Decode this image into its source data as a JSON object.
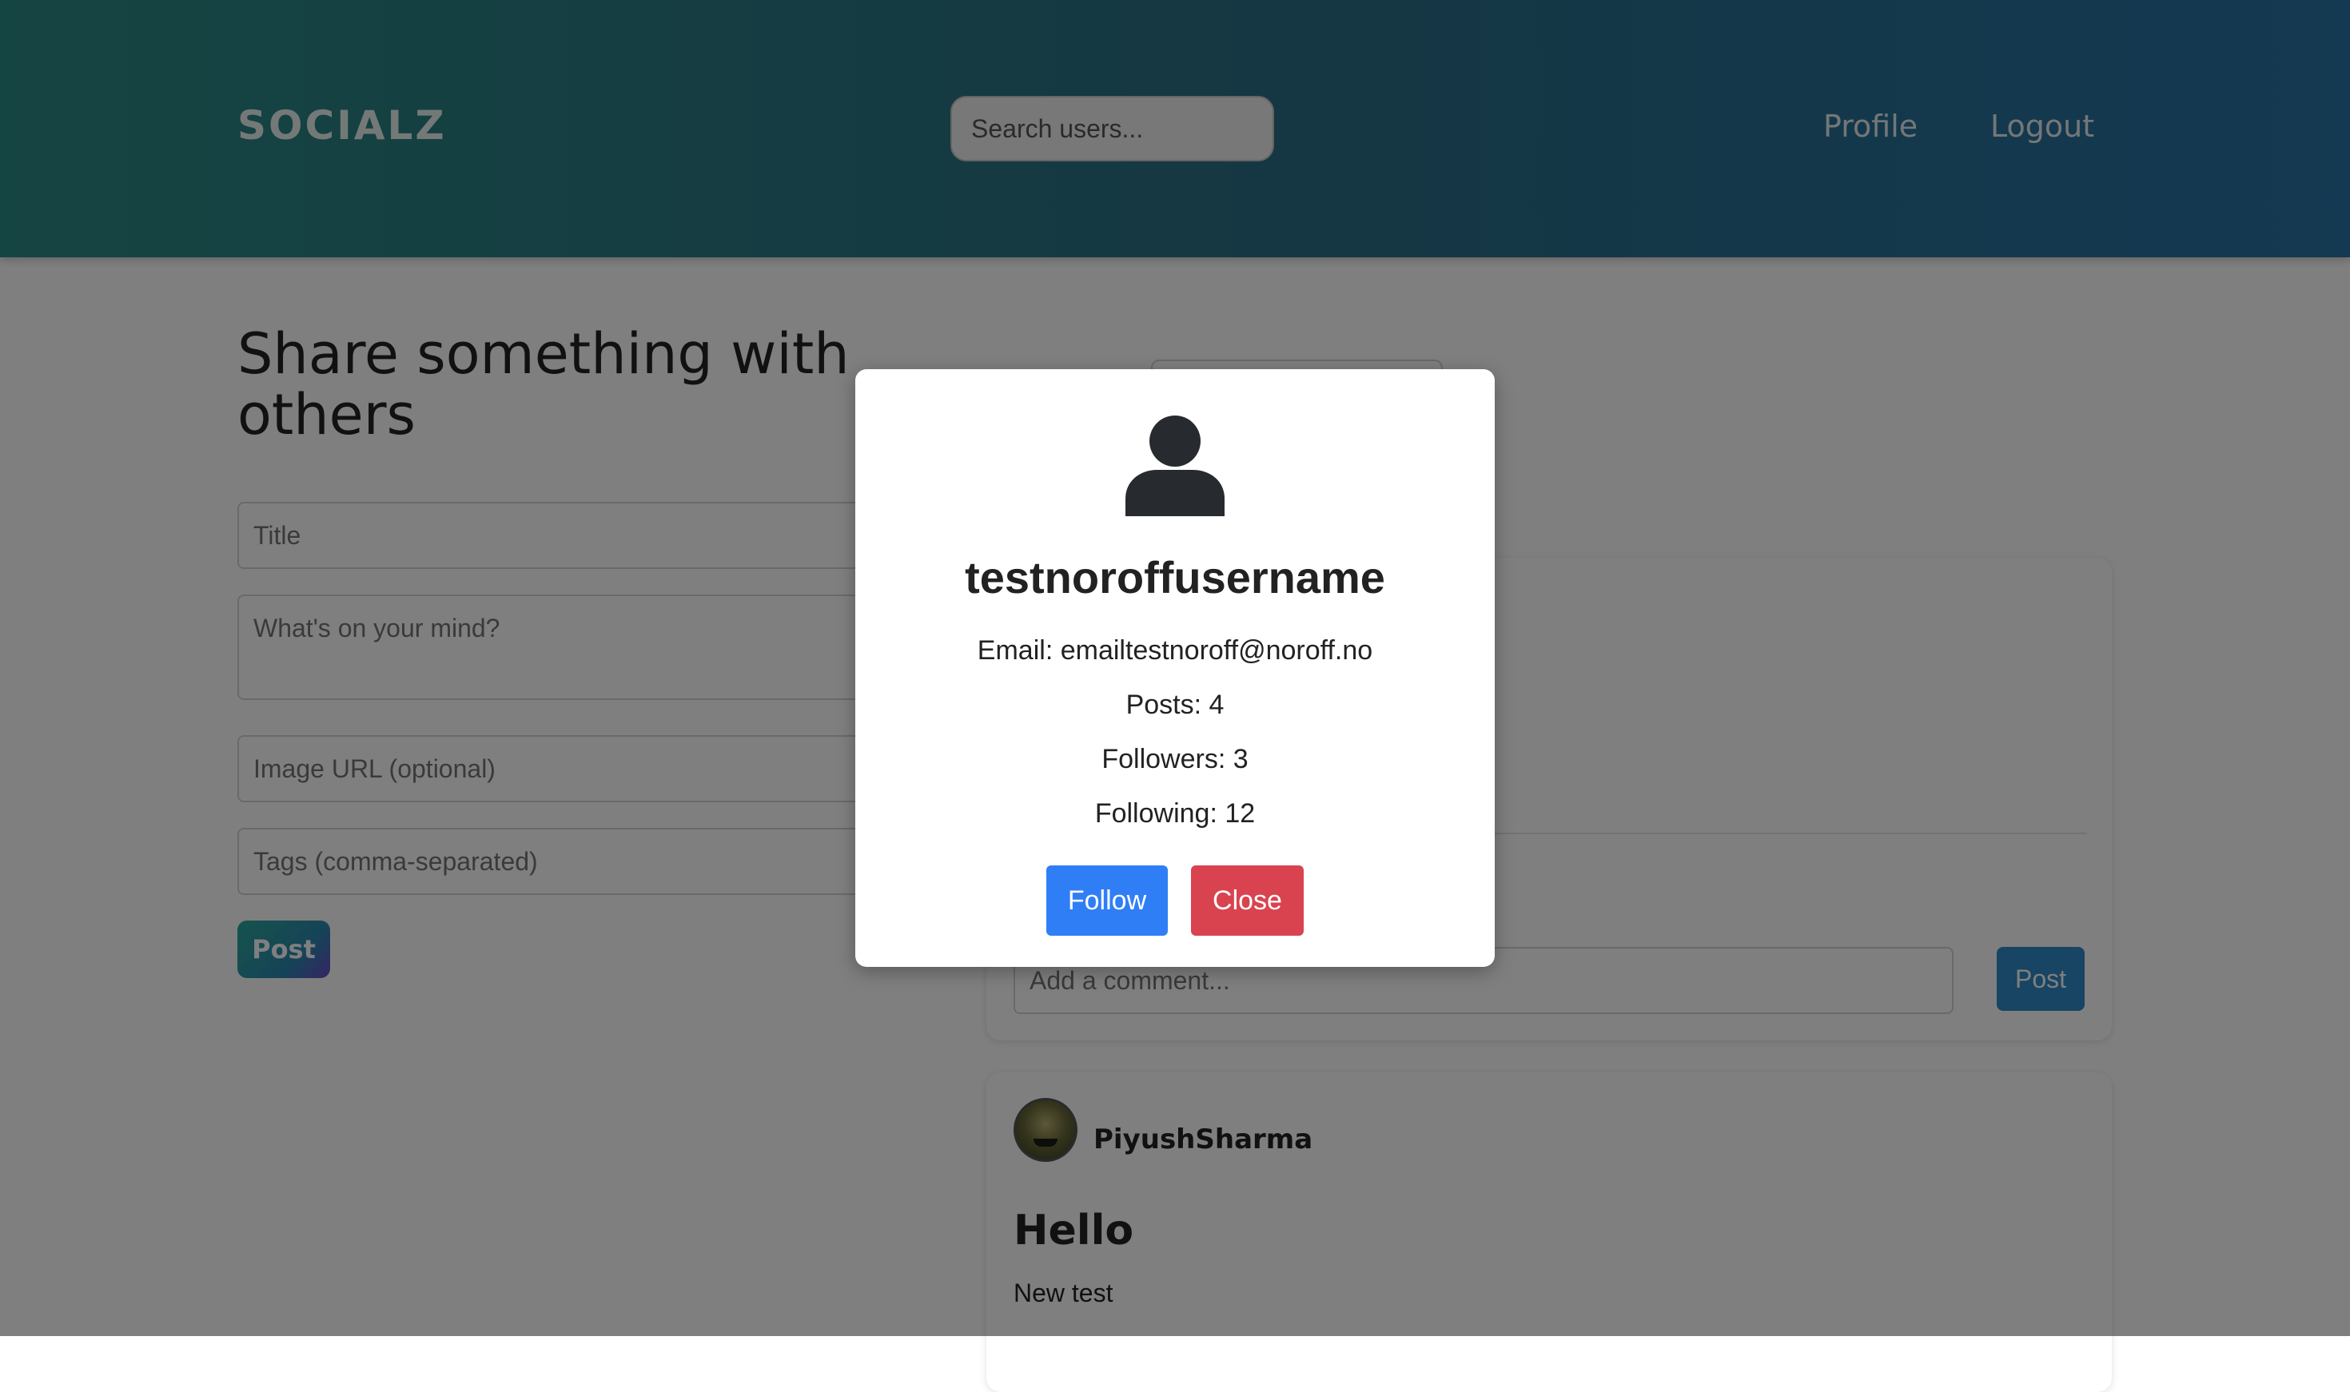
{
  "header": {
    "brand": "SOCIALZ",
    "search_placeholder": "Search users...",
    "nav": {
      "profile": "Profile",
      "logout": "Logout"
    }
  },
  "composer": {
    "heading": "Share something with others",
    "title_placeholder": "Title",
    "body_placeholder": "What's on your mind?",
    "image_placeholder": "Image URL (optional)",
    "tags_placeholder": "Tags (comma-separated)",
    "post_label": "Post"
  },
  "feed": {
    "comment_placeholder": "Add a comment...",
    "comment_post_label": "Post",
    "post": {
      "author": "PiyushSharma",
      "title": "Hello",
      "body": "New test"
    }
  },
  "modal": {
    "icon": "user-icon",
    "username": "testnoroffusername",
    "email_line": "Email: emailtestnoroff@noroff.no",
    "posts_line": "Posts: 4",
    "followers_line": "Followers: 3",
    "following_line": "Following: 12",
    "follow_label": "Follow",
    "close_label": "Close",
    "colors": {
      "follow": "#2f7ef6",
      "close": "#d9434f"
    }
  }
}
